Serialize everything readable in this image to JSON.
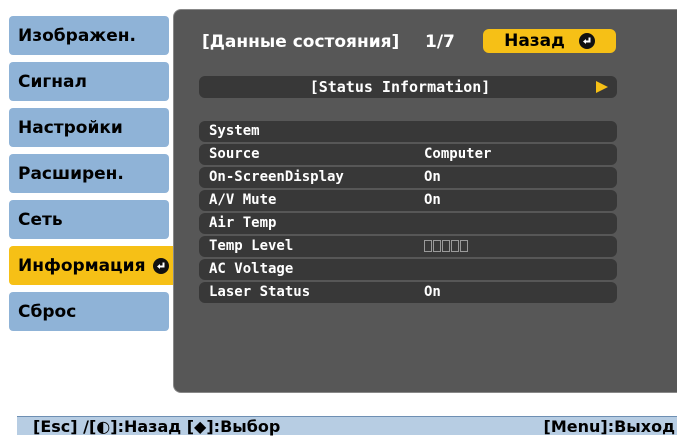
{
  "menu": {
    "items": [
      {
        "label": "Изображен."
      },
      {
        "label": "Сигнал"
      },
      {
        "label": "Настройки"
      },
      {
        "label": "Расширен."
      },
      {
        "label": "Сеть"
      },
      {
        "label": "Информация",
        "active": true
      },
      {
        "label": "Сброс"
      }
    ]
  },
  "header": {
    "title": "[Данные состояния]",
    "page": "1/7",
    "back_label": "Назад"
  },
  "section": {
    "title": "[Status Information]"
  },
  "rows": [
    {
      "label": "System",
      "value": ""
    },
    {
      "label": "Source",
      "value": "Computer"
    },
    {
      "label": "On-ScreenDisplay",
      "value": "On"
    },
    {
      "label": "A/V Mute",
      "value": "On"
    },
    {
      "label": "Air Temp",
      "value": ""
    },
    {
      "label": "Temp Level",
      "value": ""
    },
    {
      "label": "AC Voltage",
      "value": ""
    },
    {
      "label": "Laser Status",
      "value": "On"
    }
  ],
  "footer": {
    "left": "[Esc] /[◐]:Назад   [◆]:Выбор",
    "right": "[Menu]:Выход"
  },
  "colors": {
    "menu_item": "#8fb3d7",
    "accent": "#f6c016",
    "panel": "#575757",
    "row": "#383838",
    "footer": "#b7cde3"
  }
}
